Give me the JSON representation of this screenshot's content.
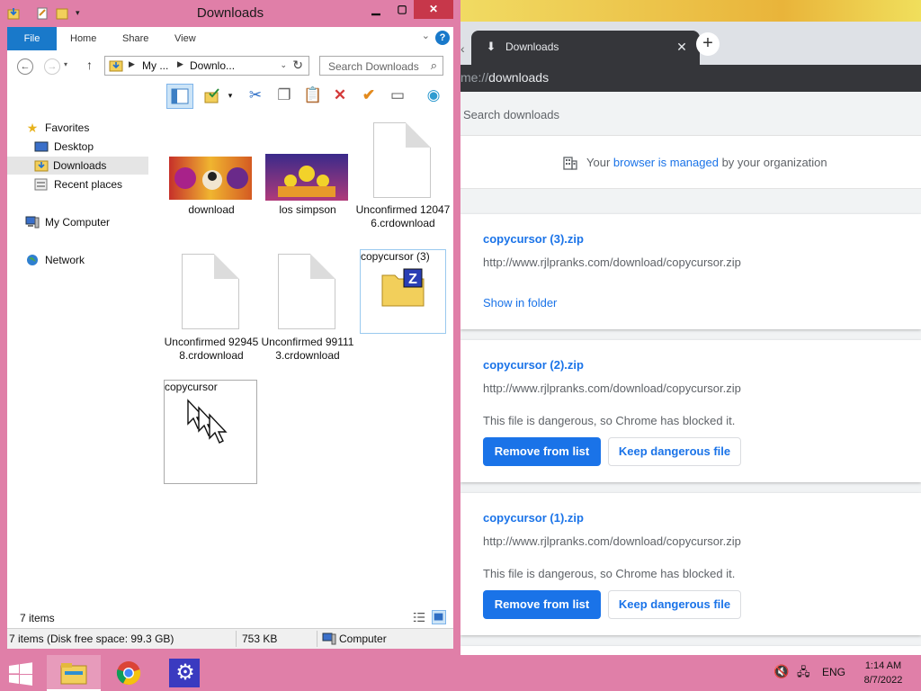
{
  "explorer": {
    "title": "Downloads",
    "ribbon_tabs": [
      "File",
      "Home",
      "Share",
      "View"
    ],
    "help": "?",
    "path": {
      "seg1": "My ...",
      "seg2": "Downlo..."
    },
    "search_placeholder": "Search Downloads",
    "nav": {
      "favorites": "Favorites",
      "desktop": "Desktop",
      "downloads": "Downloads",
      "recent": "Recent places",
      "computer": "My Computer",
      "network": "Network"
    },
    "items": [
      {
        "caption": "download"
      },
      {
        "caption": "los simpson"
      },
      {
        "caption": "Unconfirmed 120476.crdownload"
      },
      {
        "caption": "Unconfirmed 929458.crdownload"
      },
      {
        "caption": "Unconfirmed 991113.crdownload"
      },
      {
        "caption": "copycursor (3)"
      },
      {
        "caption": "copycursor"
      }
    ],
    "item_count": "7 items",
    "status": {
      "disk": "7 items (Disk free space: 99.3 GB)",
      "size": "753 KB",
      "location": "Computer"
    }
  },
  "chrome": {
    "tab_title": "Downloads",
    "url_prefix": "me://",
    "url_main": "downloads",
    "search_label": "Search downloads",
    "managed": {
      "pre": "Your ",
      "link": "browser is managed",
      "post": " by your organization"
    },
    "downloads": [
      {
        "name": "copycursor (3).zip",
        "url": "http://www.rjlpranks.com/download/copycursor.zip",
        "action": "Show in folder"
      },
      {
        "name": "copycursor (2).zip",
        "url": "http://www.rjlpranks.com/download/copycursor.zip",
        "warning": "This file is dangerous, so Chrome has blocked it.",
        "remove": "Remove from list",
        "keep": "Keep dangerous file"
      },
      {
        "name": "copycursor (1).zip",
        "url": "http://www.rjlpranks.com/download/copycursor.zip",
        "warning": "This file is dangerous, so Chrome has blocked it.",
        "remove": "Remove from list",
        "keep": "Keep dangerous file"
      }
    ]
  },
  "taskbar": {
    "language": "ENG",
    "time": "1:14 AM",
    "date": "8/7/2022"
  },
  "colors": {
    "window_frame": "#e07fa8",
    "accent_blue": "#1a73e8",
    "ribbon_file": "#1979ca"
  }
}
